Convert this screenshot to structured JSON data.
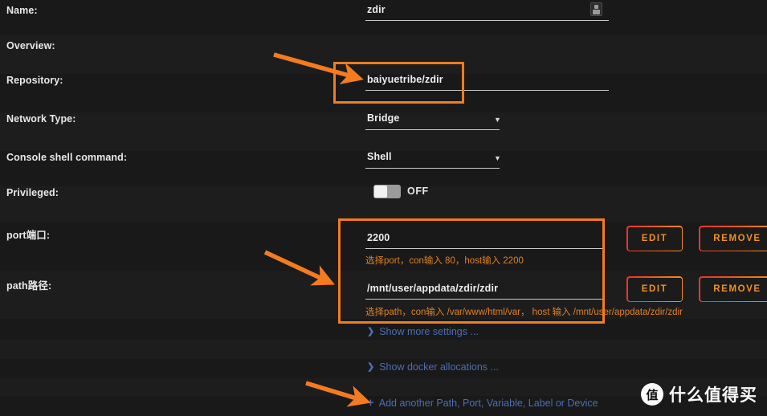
{
  "colors": {
    "background": "#191919",
    "band_alt": "#1d1d1d",
    "highlight": "#f47b20",
    "helper_text": "#e08020",
    "link": "#4a6fb5",
    "button_text": "#f2901f",
    "label_text": "#e8e8e8"
  },
  "fields": [
    {
      "label": "Name:",
      "value": "zdir",
      "icon": "contact-card-icon"
    },
    {
      "label": "Overview:",
      "value": ""
    },
    {
      "label": "Repository:",
      "value": "baiyuetribe/zdir"
    },
    {
      "label": "Network Type:",
      "value": "Bridge",
      "icon": "chevron-down-icon"
    },
    {
      "label": "Console shell command:",
      "value": "Shell",
      "icon": "chevron-down-icon"
    },
    {
      "label": "Privileged:",
      "value": "OFF",
      "toggle_state": "off"
    }
  ],
  "mappings": {
    "port": {
      "label": "port端口:",
      "value": "2200",
      "helper": "选择port，con输入 80，host输入 2200",
      "edit_label": "EDIT",
      "remove_label": "REMOVE"
    },
    "path": {
      "label": "path路径:",
      "value": "/mnt/user/appdata/zdir/zdir",
      "helper": "选择path，con输入 /var/www/html/var， host 输入 /mnt/user/appdata/zdir/zdir",
      "edit_label": "EDIT",
      "remove_label": "REMOVE"
    }
  },
  "links": [
    {
      "label": "Show more settings ...",
      "icon": "chevron-down-icon"
    },
    {
      "label": "Show docker allocations ...",
      "icon": "chevron-down-icon"
    },
    {
      "label": "Add another Path, Port, Variable, Label or Device",
      "icon": "plus-icon"
    }
  ],
  "watermark": {
    "logo_glyph": "值",
    "text": "什么值得买"
  }
}
